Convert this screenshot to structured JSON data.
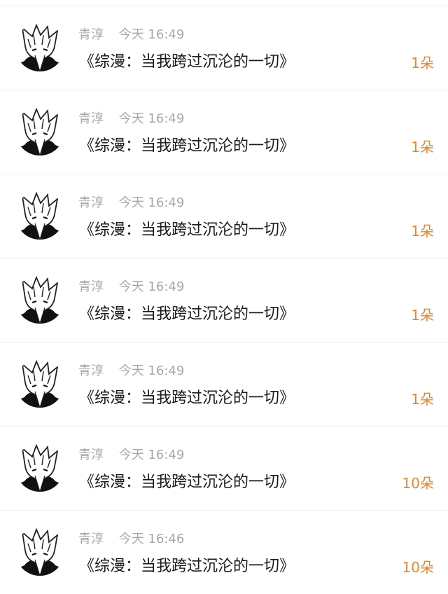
{
  "gifts": [
    {
      "user": "青淳",
      "time": "今天 16:49",
      "title": "《综漫：当我跨过沉沦的一切》",
      "amount": "1朵"
    },
    {
      "user": "青淳",
      "time": "今天 16:49",
      "title": "《综漫：当我跨过沉沦的一切》",
      "amount": "1朵"
    },
    {
      "user": "青淳",
      "time": "今天 16:49",
      "title": "《综漫：当我跨过沉沦的一切》",
      "amount": "1朵"
    },
    {
      "user": "青淳",
      "time": "今天 16:49",
      "title": "《综漫：当我跨过沉沦的一切》",
      "amount": "1朵"
    },
    {
      "user": "青淳",
      "time": "今天 16:49",
      "title": "《综漫：当我跨过沉沦的一切》",
      "amount": "1朵"
    },
    {
      "user": "青淳",
      "time": "今天 16:49",
      "title": "《综漫：当我跨过沉沦的一切》",
      "amount": "10朵"
    },
    {
      "user": "青淳",
      "time": "今天 16:46",
      "title": "《综漫：当我跨过沉沦的一切》",
      "amount": "10朵"
    }
  ],
  "colors": {
    "accent": "#e5862e",
    "meta_text": "#a8a8a8",
    "title_text": "#1a1a1a",
    "divider": "#f0f0f0"
  },
  "icons": {
    "avatar": "anime-avatar-icon"
  }
}
